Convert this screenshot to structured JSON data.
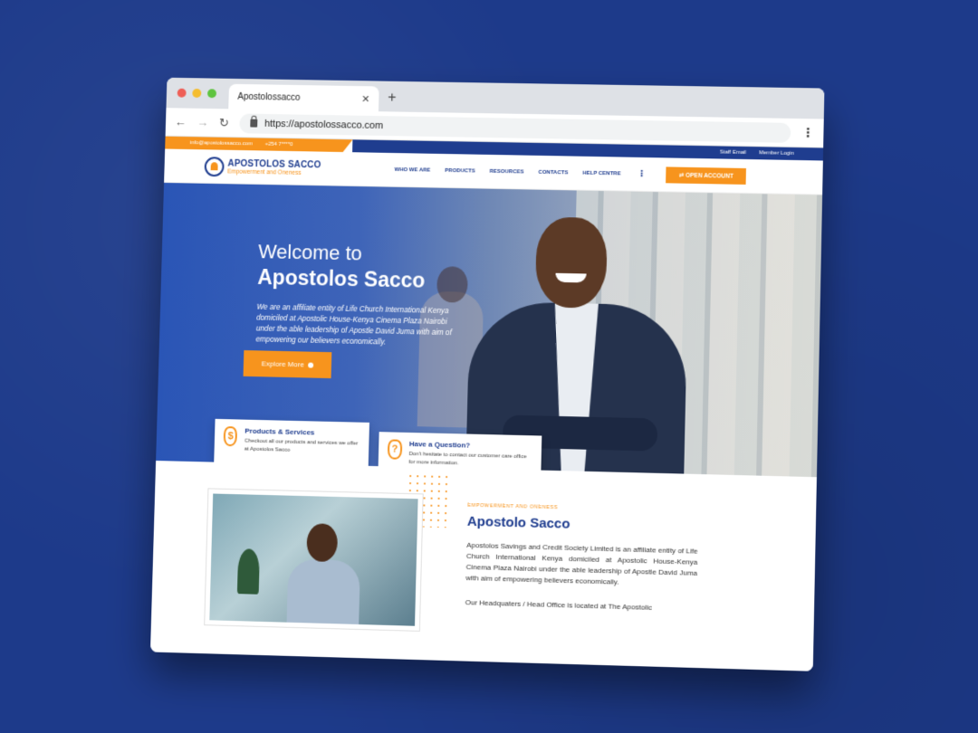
{
  "browser": {
    "tab_title": "Apostolossacco",
    "tab_close": "✕",
    "new_tab": "+",
    "url": "https://apostolossacco.com",
    "back": "←",
    "forward": "→",
    "reload": "↻",
    "menu": "⋮"
  },
  "topbar": {
    "email": "info@apostolossacco.com",
    "phone": "+254 7****0",
    "staff_email": "Staff Email",
    "member_login": "Member Login"
  },
  "header": {
    "logo_name": "APOSTOLOS SACCO",
    "logo_tagline": "Empowerment and Oneness",
    "menu": [
      "WHO WE ARE",
      "PRODUCTS",
      "RESOURCES",
      "CONTACTS",
      "HELP CENTRE"
    ],
    "menu_more": "⋮",
    "open_account": "⇄ OPEN ACCOUNT"
  },
  "hero": {
    "welcome": "Welcome to",
    "title": "Apostolos Sacco",
    "description": "We are an affiliate entity of Life Church International Kenya domiciled at Apostolic House-Kenya Cinema Plaza Nairobi under the able leadership of Apostle David Juma with aim of empowering our believers economically.",
    "cta": "Explore More"
  },
  "cards": [
    {
      "icon": "$",
      "title": "Products & Services",
      "desc": "Checkout all our products and services we offer at Apostolos Sacco"
    },
    {
      "icon": "?",
      "title": "Have a Question?",
      "desc": "Don't hesitate to contact our customer care office for more information."
    }
  ],
  "about": {
    "eyebrow": "EMPOWERMENT AND ONENESS",
    "heading": "Apostolo Sacco",
    "paragraph": "Apostolos Savings and Credit Society Limited is an affiliate entity of Life Church International Kenya domiciled at Apostolic House-Kenya Cinema Plaza Nairobi under the able leadership of Apostle David Juma with aim of empowering believers economically.",
    "paragraph2": "Our Headquaters / Head Office is located at The Apostolic"
  },
  "colors": {
    "brand_blue": "#1f3d8f",
    "brand_orange": "#f7941d",
    "background": "#1d3a8a"
  }
}
